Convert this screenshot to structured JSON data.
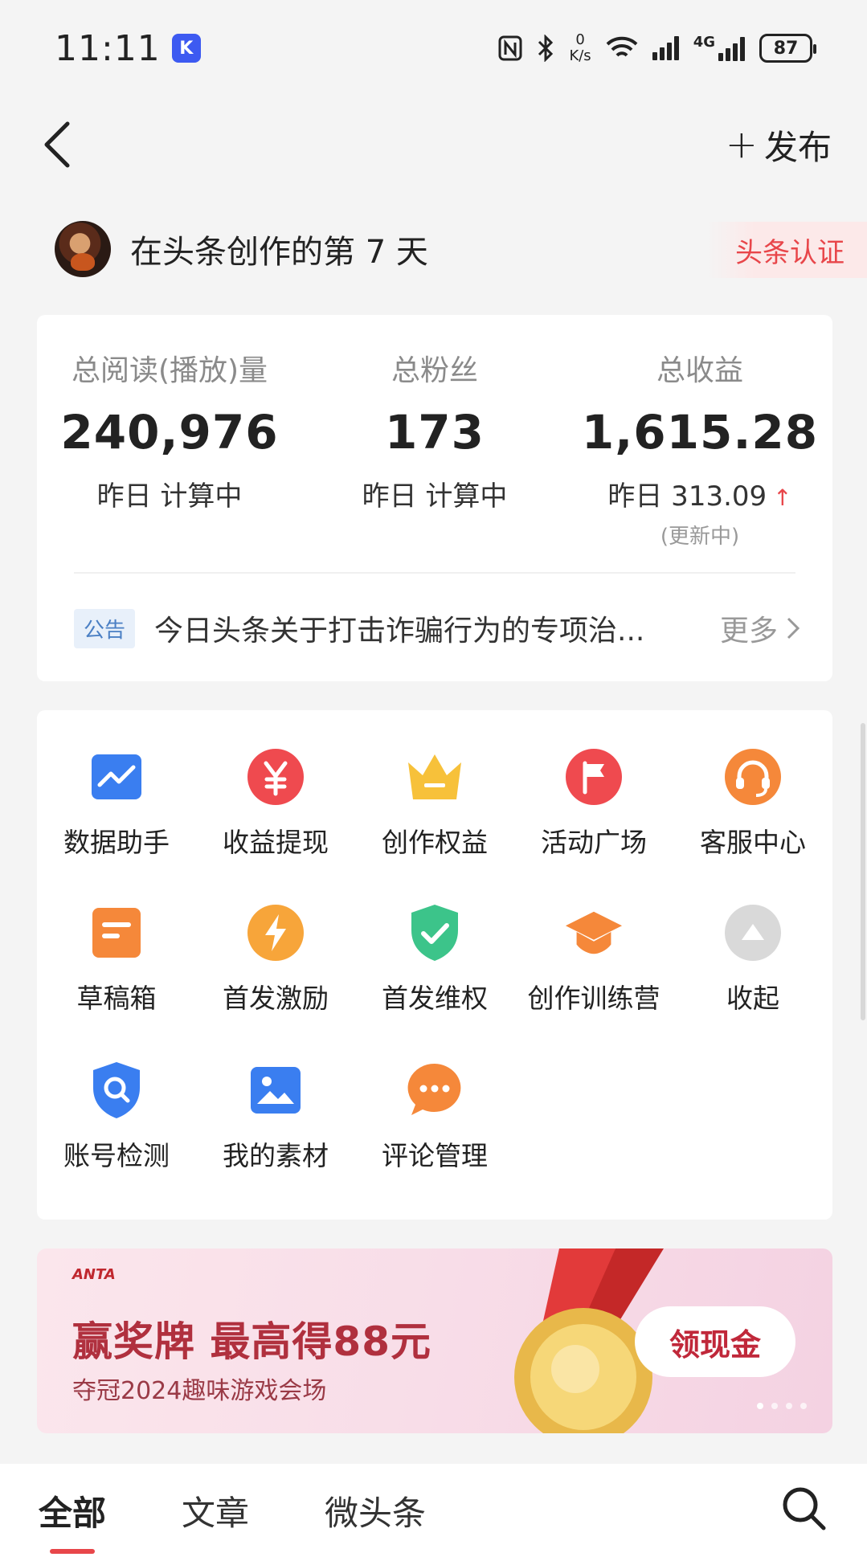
{
  "status": {
    "time": "11:11",
    "app_badge": "K",
    "speed_value": "0",
    "speed_unit": "K/s",
    "network": "4G",
    "battery": "87"
  },
  "nav": {
    "publish_label": "发布"
  },
  "creator": {
    "days_text": "在头条创作的第 7 天",
    "cert_label": "头条认证"
  },
  "stats": {
    "reads": {
      "label": "总阅读(播放)量",
      "value": "240,976",
      "sub": "昨日 计算中"
    },
    "fans": {
      "label": "总粉丝",
      "value": "173",
      "sub": "昨日 计算中"
    },
    "income": {
      "label": "总收益",
      "value": "1,615.28",
      "sub": "昨日 313.09",
      "note": "(更新中)"
    }
  },
  "notice": {
    "tag": "公告",
    "text": "今日头条关于打击诈骗行为的专项治...",
    "more": "更多"
  },
  "tools": [
    {
      "label": "数据助手",
      "icon": "chart-icon",
      "color": "#3a7ef0"
    },
    {
      "label": "收益提现",
      "icon": "yuan-icon",
      "color": "#ef4a4f"
    },
    {
      "label": "创作权益",
      "icon": "crown-icon",
      "color": "#f7c13a"
    },
    {
      "label": "活动广场",
      "icon": "flag-icon",
      "color": "#ef4a4f"
    },
    {
      "label": "客服中心",
      "icon": "headset-icon",
      "color": "#f5883a"
    },
    {
      "label": "草稿箱",
      "icon": "draft-icon",
      "color": "#f5883a"
    },
    {
      "label": "首发激励",
      "icon": "lightning-icon",
      "color": "#f7a53a"
    },
    {
      "label": "首发维权",
      "icon": "shield-check-icon",
      "color": "#3cc48a"
    },
    {
      "label": "创作训练营",
      "icon": "graduation-cap-icon",
      "color": "#f5883a"
    },
    {
      "label": "收起",
      "icon": "collapse-icon",
      "color": "#d9d9d9"
    },
    {
      "label": "账号检测",
      "icon": "shield-search-icon",
      "color": "#3a7ef0"
    },
    {
      "label": "我的素材",
      "icon": "image-icon",
      "color": "#3a7ef0"
    },
    {
      "label": "评论管理",
      "icon": "comment-icon",
      "color": "#f5883a"
    }
  ],
  "banner": {
    "logo": "ANTA",
    "title": "赢奖牌 最高得88元",
    "subtitle": "夺冠2024趣味游戏会场",
    "cta": "领现金"
  },
  "tabs": [
    {
      "label": "全部"
    },
    {
      "label": "文章"
    },
    {
      "label": "微头条"
    }
  ],
  "colors": {
    "accent_red": "#e8464a",
    "banner_text": "#b0303e"
  }
}
